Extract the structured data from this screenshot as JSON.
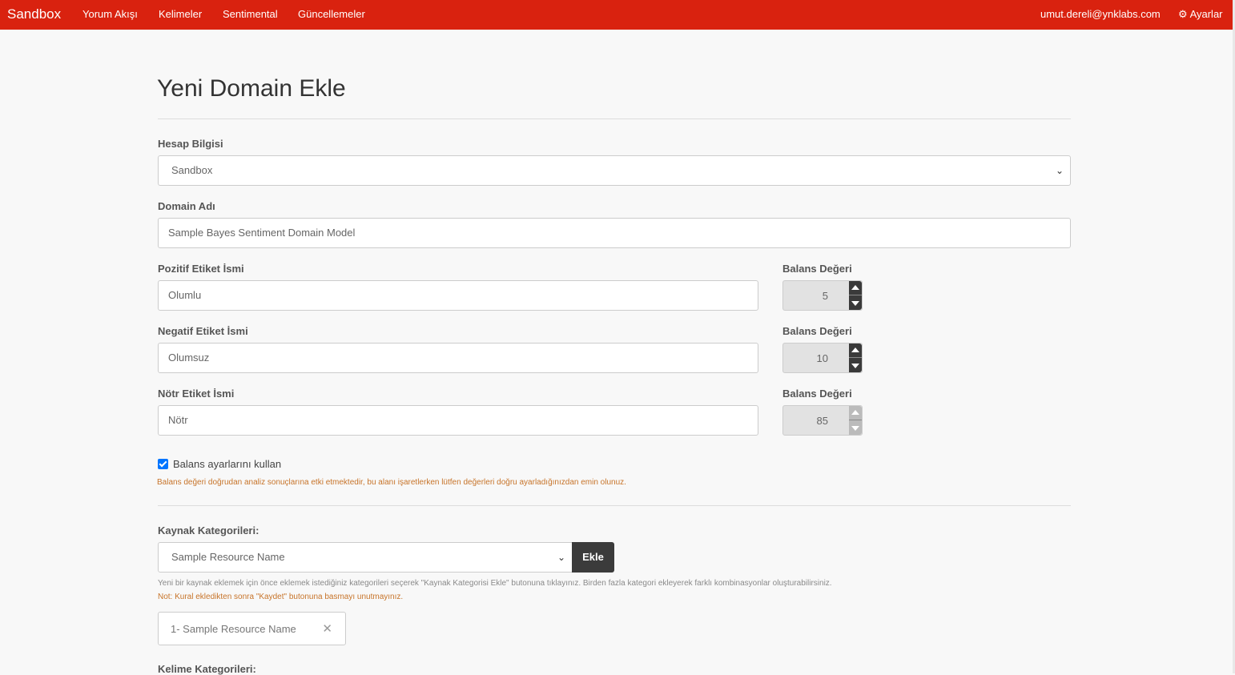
{
  "navbar": {
    "brand": "Sandbox",
    "links": [
      "Yorum Akışı",
      "Kelimeler",
      "Sentimental",
      "Güncellemeler"
    ],
    "user_email": "umut.dereli@ynklabs.com",
    "settings_label": "Ayarlar",
    "settings_icon": "gear-icon",
    "bg_color": "#d9220f"
  },
  "page": {
    "title": "Yeni Domain Ekle"
  },
  "form": {
    "account_label": "Hesap Bilgisi",
    "account_value": "Sandbox",
    "domain_label": "Domain Adı",
    "domain_placeholder": "Sample Bayes Sentiment Domain Model",
    "positive_label": "Pozitif Etiket İsmi",
    "positive_placeholder": "Olumlu",
    "negative_label": "Negatif Etiket İsmi",
    "negative_placeholder": "Olumsuz",
    "neutral_label": "Nötr Etiket İsmi",
    "neutral_placeholder": "Nötr",
    "balance_label": "Balans Değeri",
    "balance_positive": "5",
    "balance_negative": "10",
    "balance_neutral": "85",
    "use_balance_label": "Balans ayarlarını kullan",
    "use_balance_checked": true,
    "balance_warning": "Balans değeri doğrudan analiz sonuçlarına etki etmektedir, bu alanı işaretlerken lütfen değerleri doğru ayarladığınızdan emin olunuz.",
    "resource_categories_label": "Kaynak Kategorileri:",
    "resource_select_value": "Sample Resource Name",
    "add_button": "Ekle",
    "resource_help": "Yeni bir kaynak eklemek için önce eklemek istediğiniz kategorileri seçerek \"Kaynak Kategorisi Ekle\" butonuna tıklayınız. Birden fazla kategori ekleyerek farklı kombinasyonlar oluşturabilirsiniz.",
    "resource_note": "Not: Kural ekledikten sonra \"Kaydet\" butonuna basmayı unutmayınız.",
    "resource_chip": "1- Sample Resource Name",
    "word_categories_label": "Kelime Kategorileri:"
  }
}
